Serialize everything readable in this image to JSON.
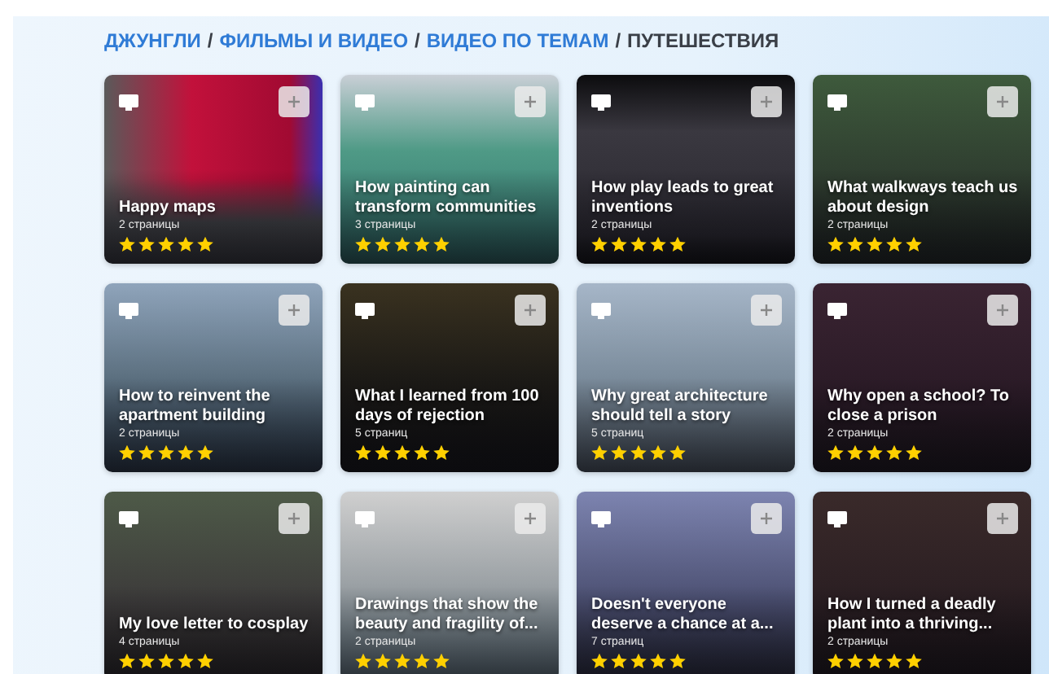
{
  "breadcrumb": [
    {
      "label": "ДЖУНГЛИ",
      "current": false
    },
    {
      "separator": "/",
      "label": "ФИЛЬМЫ И ВИДЕО",
      "current": false
    },
    {
      "separator": "/",
      "label": "ВИДЕО ПО ТЕМАМ",
      "current": false
    },
    {
      "separator": "/",
      "label": "ПУТЕШЕСТВИЯ",
      "current": true
    }
  ],
  "cards": [
    {
      "title": "Happy maps",
      "pages": "2 страницы",
      "stars": 5
    },
    {
      "title": "How painting can transform communities",
      "pages": "3 страницы",
      "stars": 5
    },
    {
      "title": "How play leads to great inventions",
      "pages": "2 страницы",
      "stars": 5
    },
    {
      "title": "What walkways teach us about design",
      "pages": "2 страницы",
      "stars": 5
    },
    {
      "title": "How to reinvent the apartment building",
      "pages": "2 страницы",
      "stars": 5
    },
    {
      "title": "What I learned from 100 days of rejection",
      "pages": "5 страниц",
      "stars": 5
    },
    {
      "title": "Why great architecture should tell a story",
      "pages": "5 страниц",
      "stars": 5
    },
    {
      "title": "Why open a school? To close a prison",
      "pages": "2 страницы",
      "stars": 5
    },
    {
      "title": "My love letter to cosplay",
      "pages": "4 страницы",
      "stars": 5
    },
    {
      "title": "Drawings that show the beauty and fragility of...",
      "pages": "2 страницы",
      "stars": 5
    },
    {
      "title": "Doesn't everyone deserve a chance at a...",
      "pages": "7 страниц",
      "stars": 5
    },
    {
      "title": "How I turned a deadly plant into a thriving...",
      "pages": "2 страницы",
      "stars": 5
    }
  ]
}
